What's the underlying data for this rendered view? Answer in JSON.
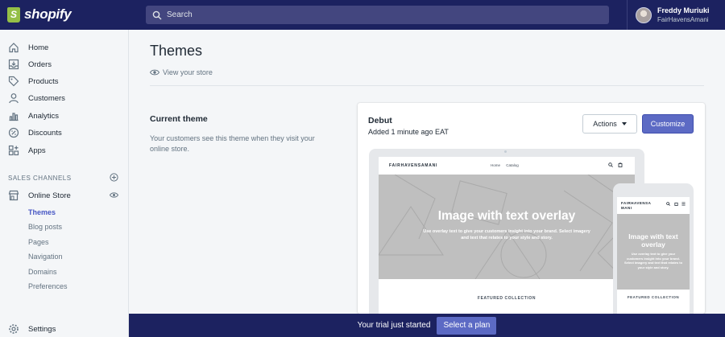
{
  "topbar": {
    "logo_text": "shopify",
    "search_placeholder": "Search",
    "user_name": "Freddy Muriuki",
    "user_store": "FairHavensAmani"
  },
  "sidebar": {
    "items": [
      {
        "label": "Home",
        "icon": "home-icon"
      },
      {
        "label": "Orders",
        "icon": "orders-icon"
      },
      {
        "label": "Products",
        "icon": "tag-icon"
      },
      {
        "label": "Customers",
        "icon": "person-icon"
      },
      {
        "label": "Analytics",
        "icon": "bar-chart-icon"
      },
      {
        "label": "Discounts",
        "icon": "discount-icon"
      },
      {
        "label": "Apps",
        "icon": "apps-icon"
      }
    ],
    "section_label": "SALES CHANNELS",
    "online_store": "Online Store",
    "sub_items": [
      "Themes",
      "Blog posts",
      "Pages",
      "Navigation",
      "Domains",
      "Preferences"
    ],
    "settings": "Settings"
  },
  "main": {
    "title": "Themes",
    "view_store": "View your store",
    "current_title": "Current theme",
    "current_desc": "Your customers see this theme when they visit your online store."
  },
  "card": {
    "theme_name": "Debut",
    "added": "Added 1 minute ago EAT",
    "actions_label": "Actions",
    "customize_label": "Customize"
  },
  "preview": {
    "brand": "FAIRHAVENSAMANI",
    "nav": [
      "Home",
      "Catalog"
    ],
    "hero_title": "Image with text overlay",
    "hero_sub": "Use overlay text to give your customers insight into your brand. Select imagery and text that relates to your style and story.",
    "featured": "FEATURED COLLECTION",
    "mobile_brand": "FAIRHAVENSA MANI"
  },
  "trial": {
    "text": "Your trial just started",
    "button": "Select a plan"
  }
}
